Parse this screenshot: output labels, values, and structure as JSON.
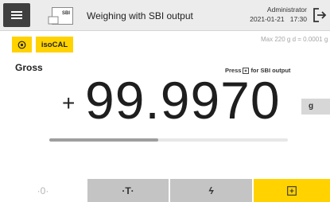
{
  "header": {
    "title": "Weighing with SBI output",
    "app_icon_label": "SBI",
    "user": "Administrator",
    "datetime": "2021-01-21   17:30",
    "menu_icon": "hamburger-menu-icon",
    "logout_icon": "logout-arrow-icon"
  },
  "status": {
    "level_icon": "leveling-target-icon",
    "calibration_label": "isoCAL",
    "max_info": "Max 220 g  d = 0.0001 g"
  },
  "display": {
    "mode_label": "Gross",
    "hint_prefix": "Press",
    "hint_suffix": "for SBI output",
    "sign": "+",
    "value": "99.9970",
    "unit": "g",
    "capacity_used_fraction": 0.455
  },
  "softkeys": [
    {
      "name": "zero",
      "label": "·0·"
    },
    {
      "name": "tare",
      "label": "·T·"
    },
    {
      "name": "function",
      "label": "ϟ"
    },
    {
      "name": "print",
      "label": "print-icon"
    }
  ],
  "colors": {
    "accent": "#ffd200",
    "header_bg": "#ececec",
    "button_gray": "#c4c4c4"
  }
}
